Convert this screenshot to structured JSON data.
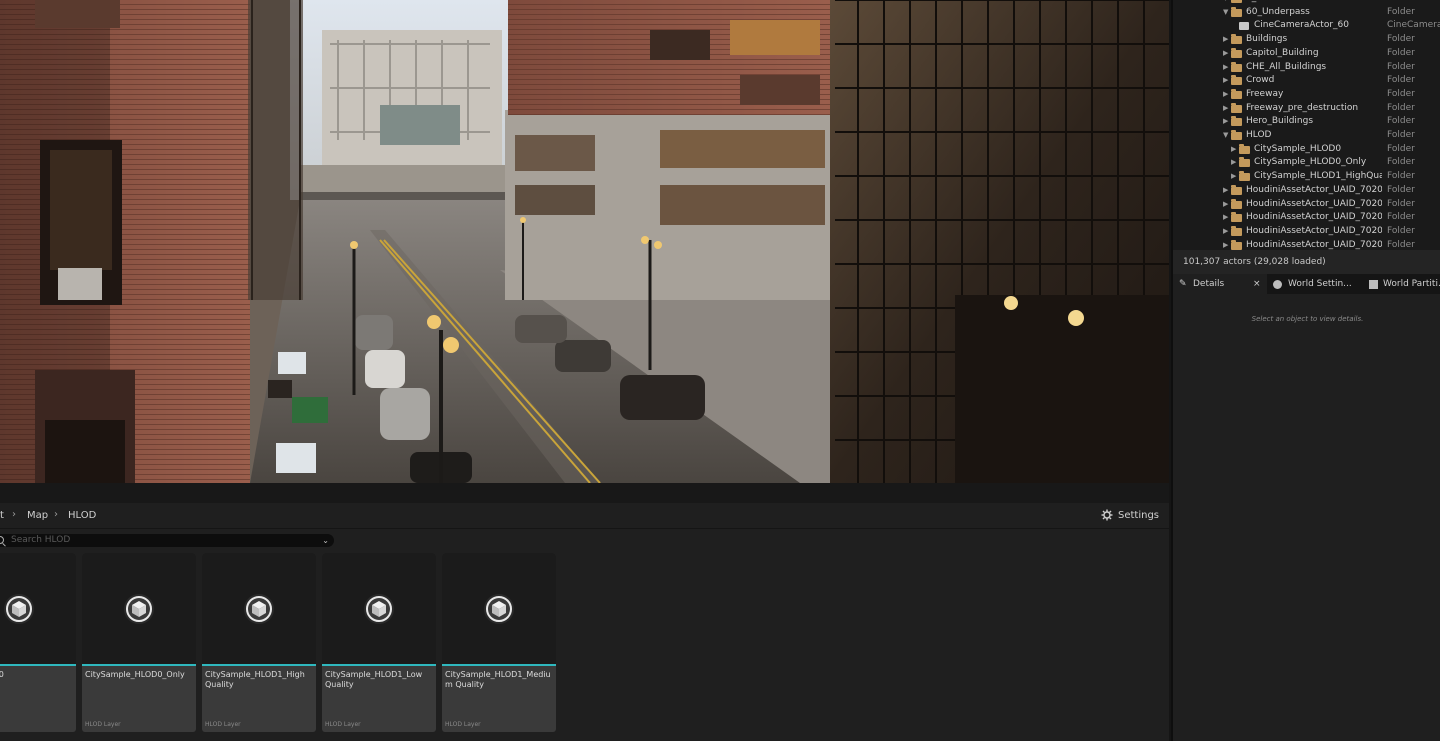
{
  "viewport": {
    "title": "Level viewport"
  },
  "breadcrumb": {
    "items": [
      "t",
      "Map",
      "HLOD"
    ],
    "settings_label": "Settings"
  },
  "search": {
    "placeholder": "Search HLOD"
  },
  "tiles": [
    {
      "name": "le_HLOD0",
      "type": ""
    },
    {
      "name": "CitySample_HLOD0_Only",
      "type": "HLOD Layer"
    },
    {
      "name": "CitySample_HLOD1_High Quality",
      "type": "HLOD Layer"
    },
    {
      "name": "CitySample_HLOD1_Low Quality",
      "type": "HLOD Layer"
    },
    {
      "name": "CitySample_HLOD1_Medium Quality",
      "type": "HLOD Layer"
    }
  ],
  "outliner": {
    "rows": [
      {
        "label": "6_SceneAssets",
        "kind": "Folder",
        "indent": 0,
        "expanded": true
      },
      {
        "label": "60_Underpass",
        "kind": "Folder",
        "indent": 0,
        "expanded": true
      },
      {
        "label": "CineCameraActor_60",
        "kind": "CineCameraA",
        "indent": 1,
        "actor": true
      },
      {
        "label": "Buildings",
        "kind": "Folder",
        "indent": 0
      },
      {
        "label": "Capitol_Building",
        "kind": "Folder",
        "indent": 0
      },
      {
        "label": "CHE_All_Buildings",
        "kind": "Folder",
        "indent": 0
      },
      {
        "label": "Crowd",
        "kind": "Folder",
        "indent": 0
      },
      {
        "label": "Freeway",
        "kind": "Folder",
        "indent": 0
      },
      {
        "label": "Freeway_pre_destruction",
        "kind": "Folder",
        "indent": 0
      },
      {
        "label": "Hero_Buildings",
        "kind": "Folder",
        "indent": 0
      },
      {
        "label": "HLOD",
        "kind": "Folder",
        "indent": 0,
        "expanded": true
      },
      {
        "label": "CitySample_HLOD0",
        "kind": "Folder",
        "indent": 1
      },
      {
        "label": "CitySample_HLOD0_Only",
        "kind": "Folder",
        "indent": 1
      },
      {
        "label": "CitySample_HLOD1_HighQuality",
        "kind": "Folder",
        "indent": 1
      },
      {
        "label": "HoudiniAssetActor_UAID_702084",
        "kind": "Folder",
        "indent": 0
      },
      {
        "label": "HoudiniAssetActor_UAID_702084",
        "kind": "Folder",
        "indent": 0
      },
      {
        "label": "HoudiniAssetActor_UAID_702084",
        "kind": "Folder",
        "indent": 0
      },
      {
        "label": "HoudiniAssetActor_UAID_702084",
        "kind": "Folder",
        "indent": 0
      },
      {
        "label": "HoudiniAssetActor_UAID_702084",
        "kind": "Folder",
        "indent": 0
      }
    ],
    "status": "101,307 actors (29,028 loaded)"
  },
  "panel_tabs": {
    "details": "Details",
    "close": "×",
    "world_settings": "World Settin...",
    "world_partition": "World Partiti..."
  },
  "details": {
    "hint": "Select an object to view details."
  },
  "colors": {
    "accent": "#2fb8be",
    "folder": "#c49a5c"
  }
}
